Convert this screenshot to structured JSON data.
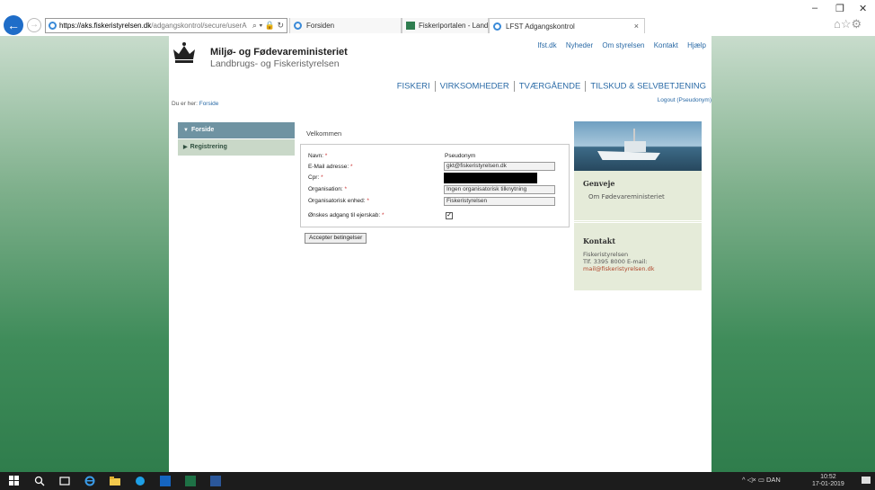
{
  "browser": {
    "address": {
      "site": "https://aks.fiskeristyrelsen.dk",
      "path": "/adgangskontrol/secure/userA"
    },
    "tabs": [
      {
        "label": "Forsiden"
      },
      {
        "label": "Fiskeriportalen - Landbrugs- o..."
      },
      {
        "label": "LFST Adgangskontrol"
      }
    ],
    "window_controls": {
      "minimize": "–",
      "maximize": "❐",
      "close": "✕"
    },
    "favorites_icons": "⌂☆⚙"
  },
  "header": {
    "ministry": "Miljø- og Fødevareministeriet",
    "agency": "Landbrugs- og Fiskeristyrelsen",
    "toplinks": [
      "lfst.dk",
      "Nyheder",
      "Om styrelsen",
      "Kontakt",
      "Hjælp"
    ],
    "mainnav": [
      "FISKERI",
      "VIRKSOMHEDER",
      "TVÆRGÅENDE",
      "TILSKUD & SELVBETJENING"
    ],
    "breadcrumb_prefix": "Du er her:",
    "breadcrumb_link": "Forside",
    "logout": "Logout (Pseudonym)"
  },
  "sidebar": {
    "items": [
      {
        "label": "Forside",
        "caret": "▼"
      },
      {
        "label": "Registrering",
        "caret": "▶"
      }
    ]
  },
  "form": {
    "welcome": "Velkommen",
    "fields": {
      "name_label": "Navn:",
      "name_value": "Pseudonym",
      "email_label": "E-Mail adresse:",
      "email_value": "gkt@fiskeristyrelsen.dk",
      "cpr_label": "Cpr:",
      "org_label": "Organisation:",
      "org_value": "Ingen organisatorisk tilknytning",
      "unit_label": "Organisatorisk enhed:",
      "unit_value": "Fiskeristyrelsen",
      "owner_label": "Ønskes adgang til ejerskab:",
      "required_mark": "*"
    },
    "checkbox_mark": "✓",
    "accept_button": "Accepter betingelser"
  },
  "rightpanel": {
    "shortcuts_title": "Genveje",
    "shortcut_link": "Om Fødevareministeriet",
    "contact_title": "Kontakt",
    "contact_name": "Fiskeristyrelsen",
    "contact_phone": "Tlf. 3395 8000 E-mail:",
    "contact_email": "mail@fiskeristyrelsen.dk"
  },
  "taskbar": {
    "tray_text": "^  ◁×  ▭  DAN",
    "time": "10:52",
    "date": "17-01-2019"
  }
}
